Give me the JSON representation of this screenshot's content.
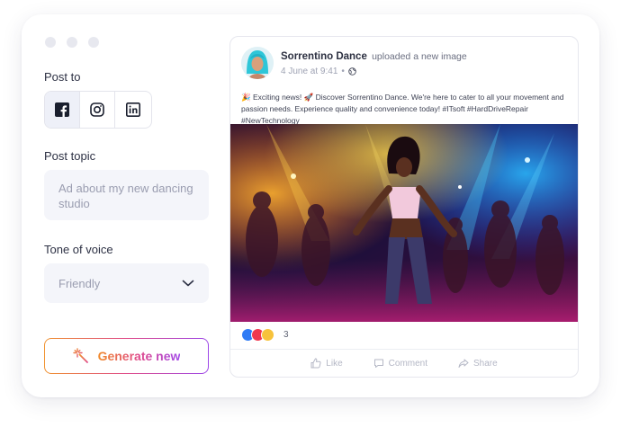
{
  "composer": {
    "post_to_label": "Post to",
    "platforms": [
      {
        "name": "facebook-icon",
        "selected": true
      },
      {
        "name": "instagram-icon",
        "selected": false
      },
      {
        "name": "linkedin-icon",
        "selected": false
      }
    ],
    "topic_label": "Post topic",
    "topic_value": "Ad about my new dancing studio",
    "tone_label": "Tone of voice",
    "tone_value": "Friendly",
    "generate_label": "Generate new",
    "generate_icon": "sparkle-wand-icon"
  },
  "post": {
    "author": "Sorrentino Dance",
    "action": "uploaded a new image",
    "timestamp": "4 June at 9:41",
    "separator": "•",
    "audience_icon": "globe-icon",
    "text": "🎉 Exciting news! 🚀 Discover Sorrentino Dance. We're here to cater to all your movement and passion needs. Experience quality and convenience today!",
    "hashtags": "#ITsoft #HardDriveRepair #NewTechnology",
    "reaction_count": "3",
    "reaction_icons": [
      "like-reaction-icon",
      "love-reaction-icon",
      "care-reaction-icon"
    ],
    "actions": {
      "like": "Like",
      "comment": "Comment",
      "share": "Share"
    }
  },
  "colors": {
    "facebook": "#1a1f2e",
    "gradient_start": "#f0922e",
    "gradient_mid": "#e04d8a",
    "gradient_end": "#9d47e8",
    "like_blue": "#2f7bf5",
    "love_red": "#f0384e",
    "care_yellow": "#f7c23b"
  }
}
